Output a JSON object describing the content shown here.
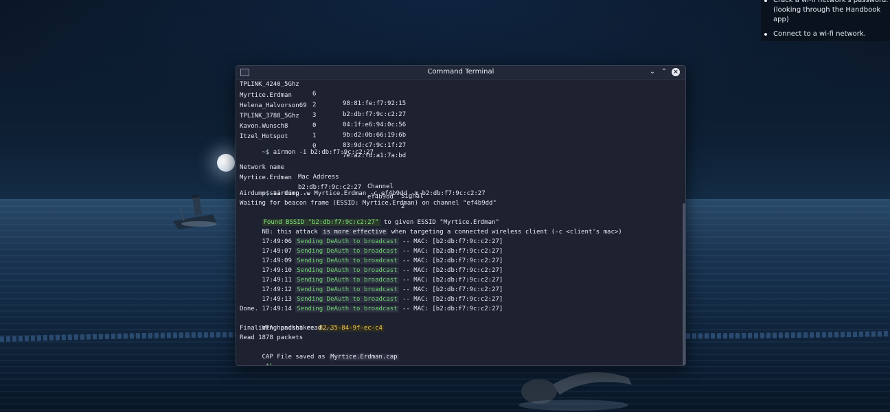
{
  "todo": {
    "items": [
      "Crack a wi-fi network's password. (looking through the Handbook app)",
      "Connect to a wi-fi network."
    ]
  },
  "window": {
    "title": "Command Terminal",
    "min_label": "⌄",
    "max_label": "⌃",
    "close_label": "×"
  },
  "networks": [
    {
      "name": "TPLINK_4240_5Ghz",
      "ch": "6",
      "mac": "98:81:fe:f7:92:15"
    },
    {
      "name": "Myrtice.Erdman",
      "ch": "2",
      "mac": "b2:db:f7:9c:c2:27"
    },
    {
      "name": "Helena_Halvorson69",
      "ch": "3",
      "mac": "04:1f:e6:94:0c:56"
    },
    {
      "name": "TPLINK_3788_5Ghz",
      "ch": "0",
      "mac": "9b:d2:0b:66:19:6b"
    },
    {
      "name": "Kavon.Wunsch8",
      "ch": "1",
      "mac": "83:9d:c7:9c:1f:27"
    },
    {
      "name": "Itzel_Hotspot",
      "ch": "0",
      "mac": "7e:a2:fd:a1:7a:bd"
    }
  ],
  "prompt": "~$",
  "cmd1": "airmon -i b2:db:f7:9c:c2:27",
  "airmon_table": {
    "headers": [
      "Network name",
      "Mac Address",
      "Channel",
      "Signal"
    ],
    "row": [
      "Myrtice.Erdman",
      "b2:db:f7:9c:c2:27",
      "ef4b9dd",
      "2"
    ]
  },
  "cmd2": "airdump -w Myrtice.Erdman -c ef4b9dd -m b2:db:f7:9c:c2:27",
  "lines": {
    "starting": "Airdump starting...",
    "waiting": "Waiting for beacon frame (ESSID: Myrtice.Erdman) on channel \"ef4b9dd\"",
    "found_hl": "Found BSSID \"b2:db:f7:9c:c2:27\"",
    "found_rest": " to given ESSID \"Myrtice.Erdman\"",
    "nb_pre": "NB: this attack ",
    "nb_hl": "is more effective",
    "nb_post": " when targeting a connected wireless client (-c <client's mac>)",
    "done": "Done.",
    "wpa_label": "WPA handshake: ",
    "wpa_value": "82-35-84-9f-ec-c4",
    "finalizing": "Finalizing packet read...",
    "read": "Read 1878 packets",
    "cap_label": "CAP File saved as ",
    "cap_value": "Myrtice.Erdman.cap"
  },
  "deauth": {
    "times": [
      "17:49:06",
      "17:49:07",
      "17:49:09",
      "17:49:10",
      "17:49:11",
      "17:49:12",
      "17:49:13",
      "17:49:14"
    ],
    "msg": "Sending DeAuth to broadcast",
    "mac": "-- MAC: [b2:db:f7:9c:c2:27]"
  }
}
